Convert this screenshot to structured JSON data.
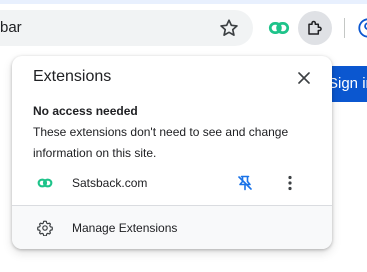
{
  "browser": {
    "omnibox_text": "bar",
    "signin_label": "Sign in",
    "icons": {
      "star": "star-icon",
      "extension_pinned": "link-icon",
      "extensions": "puzzle-icon",
      "profile": "profile-icon"
    }
  },
  "popup": {
    "title": "Extensions",
    "section_heading": "No access needed",
    "section_description": "These extensions don't need to see and change information on this site.",
    "extensions": [
      {
        "name": "Satsback.com",
        "icon": "link-icon",
        "icon_color": "#1ec38a",
        "pinned": true
      }
    ],
    "footer_label": "Manage Extensions"
  },
  "colors": {
    "accent": "#0b57d0",
    "pin_blue": "#1a73e8",
    "extension_green": "#1ec38a"
  }
}
